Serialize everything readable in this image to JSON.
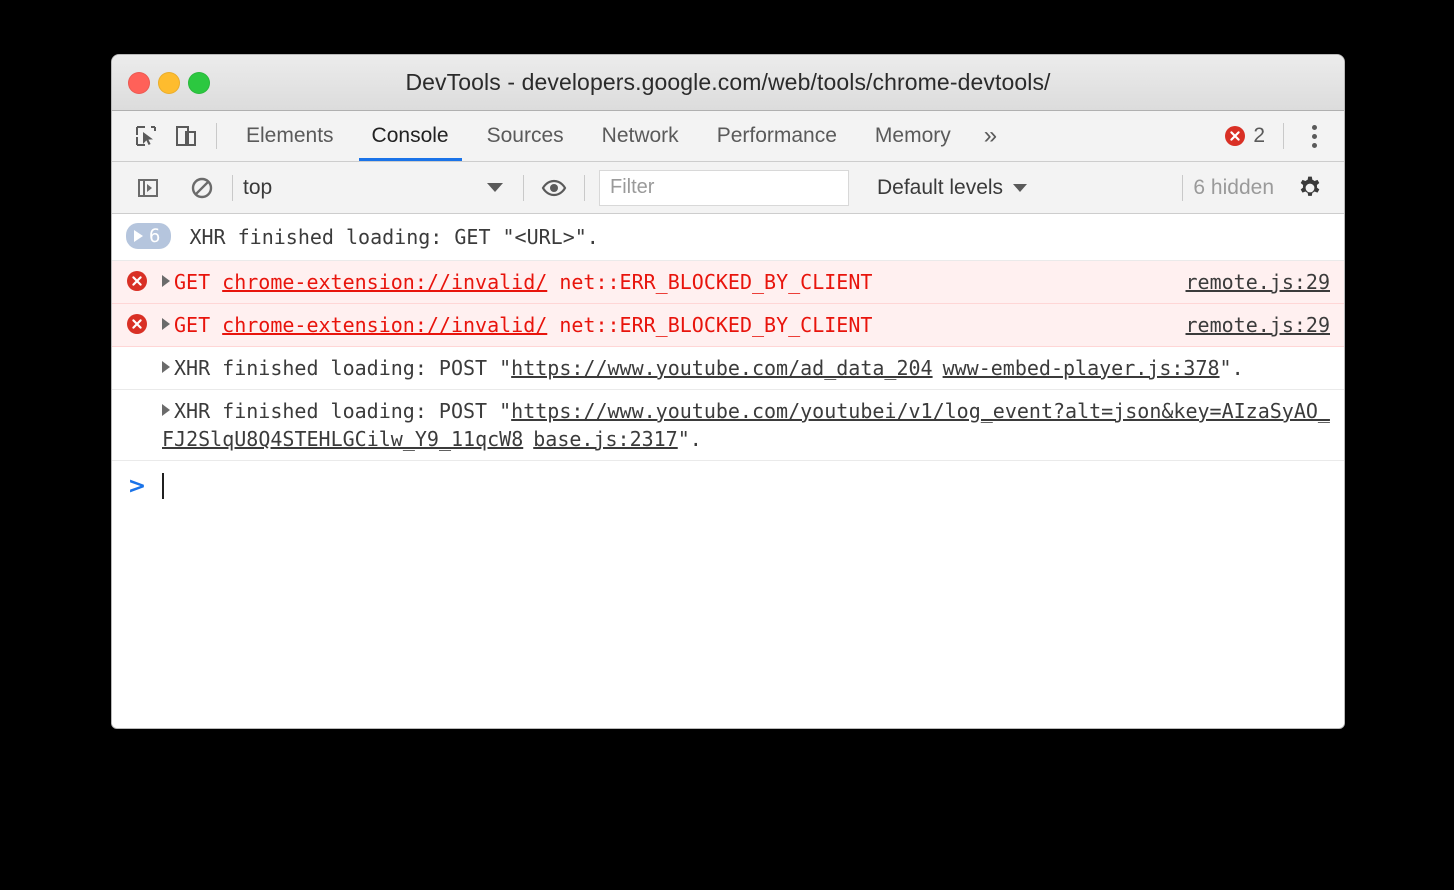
{
  "window": {
    "title": "DevTools - developers.google.com/web/tools/chrome-devtools/",
    "controls": {
      "close": "close",
      "minimize": "minimize",
      "maximize": "maximize"
    },
    "colors": {
      "close": "#ff6159",
      "minimize": "#febc2e",
      "maximize": "#2cc840",
      "accent": "#1a73e8",
      "error": "#d93025",
      "error_text": "#e8140c"
    }
  },
  "tabbar": {
    "inspect_icon": "inspect-element-icon",
    "device_icon": "device-toolbar-icon",
    "tabs": [
      {
        "label": "Elements",
        "active": false
      },
      {
        "label": "Console",
        "active": true
      },
      {
        "label": "Sources",
        "active": false
      },
      {
        "label": "Network",
        "active": false
      },
      {
        "label": "Performance",
        "active": false
      },
      {
        "label": "Memory",
        "active": false
      }
    ],
    "more_label": "»",
    "error_count": "2",
    "error_icon": "error-circle-icon",
    "menu_icon": "kebab-menu-icon"
  },
  "toolbar": {
    "sidebar_icon": "show-console-sidebar-icon",
    "clear_icon": "clear-console-icon",
    "context": "top",
    "eye_icon": "create-live-expression-icon",
    "filter_placeholder": "Filter",
    "filter_value": "",
    "levels": "Default levels",
    "hidden": "6 hidden",
    "settings_icon": "settings-gear-icon"
  },
  "console": {
    "messages": [
      {
        "type": "group",
        "badge_count": "6",
        "text": "XHR finished loading: GET \"<URL>\"."
      },
      {
        "type": "error",
        "method": "GET",
        "url": "chrome-extension://invalid/",
        "reason": "net::ERR_BLOCKED_BY_CLIENT",
        "source": "remote.js:29"
      },
      {
        "type": "error",
        "method": "GET",
        "url": "chrome-extension://invalid/",
        "reason": "net::ERR_BLOCKED_BY_CLIENT",
        "source": "remote.js:29"
      },
      {
        "type": "info",
        "prefix": "XHR finished loading: POST \"",
        "url": "https://www.youtube.com/ad_data_204",
        "suffix": "\".",
        "source": "www-embed-player.js:378"
      },
      {
        "type": "info",
        "prefix": "XHR finished loading: POST \"",
        "url": "https://www.youtube.com/youtubei/v1/log_event?alt=json&key=AIzaSyAO_FJ2SlqU8Q4STEHLGCilw_Y9_11qcW8",
        "suffix": "\".",
        "source": "base.js:2317"
      }
    ],
    "prompt": ">",
    "prompt_value": ""
  }
}
